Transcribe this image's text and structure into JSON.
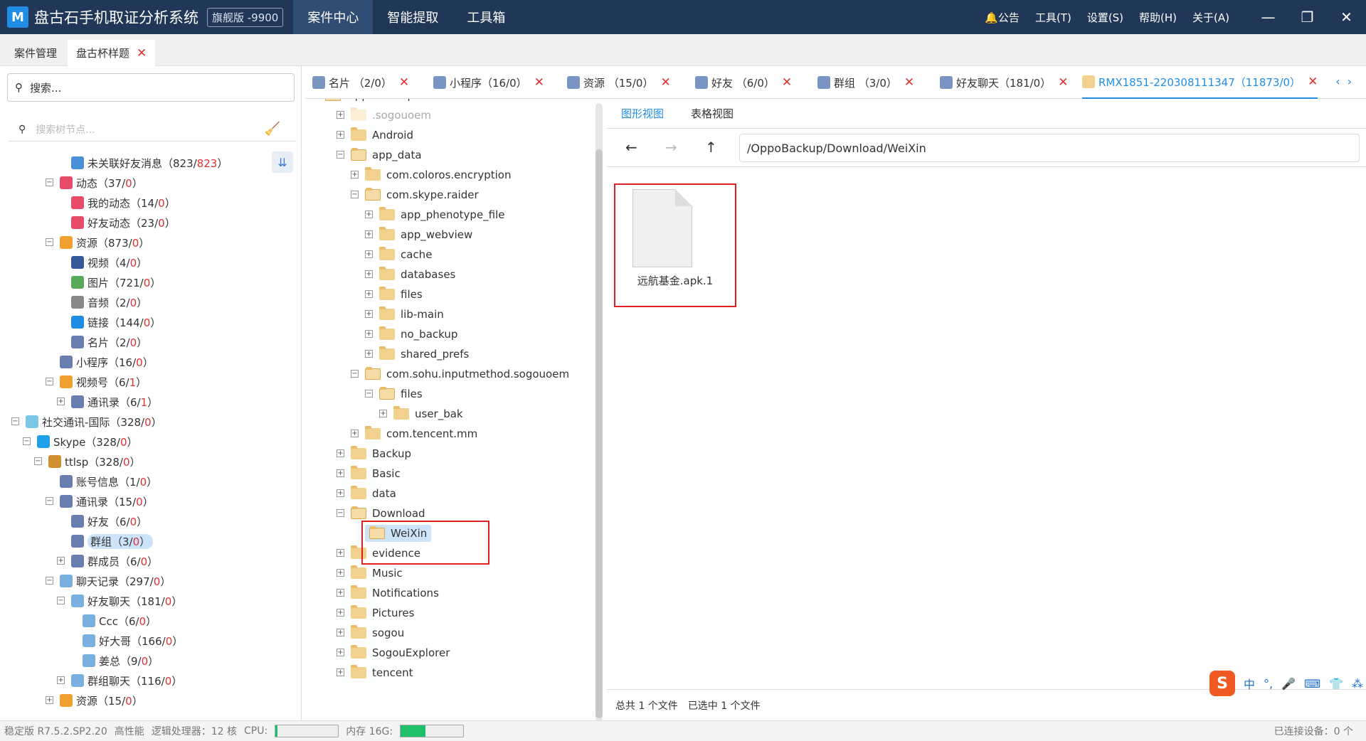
{
  "titlebar": {
    "logo": "M",
    "title": "盘古石手机取证分析系统",
    "edition": "旗舰版 -9900",
    "nav": [
      "案件中心",
      "智能提取",
      "工具箱"
    ],
    "right": [
      "公告",
      "工具(T)",
      "设置(S)",
      "帮助(H)",
      "关于(A)"
    ],
    "win": [
      "—",
      "❐",
      "✕"
    ]
  },
  "maintabs": [
    "案件管理",
    "盘古杯样题"
  ],
  "left": {
    "search": "搜索...",
    "filter": "搜索树节点...",
    "nodes": [
      {
        "label": "未关联好友消息（823/",
        "count": "823",
        "tail": "）"
      },
      {
        "label": "动态（37/",
        "count": "0",
        "tail": "）"
      },
      {
        "label": "我的动态（14/",
        "count": "0",
        "tail": "）"
      },
      {
        "label": "好友动态（23/",
        "count": "0",
        "tail": "）"
      },
      {
        "label": "资源（873/",
        "count": "0",
        "tail": "）"
      },
      {
        "label": "视频（4/",
        "count": "0",
        "tail": "）"
      },
      {
        "label": "图片（721/",
        "count": "0",
        "tail": "）"
      },
      {
        "label": "音频（2/",
        "count": "0",
        "tail": "）"
      },
      {
        "label": "链接（144/",
        "count": "0",
        "tail": "）"
      },
      {
        "label": "名片（2/",
        "count": "0",
        "tail": "）"
      },
      {
        "label": "小程序（16/",
        "count": "0",
        "tail": "）"
      },
      {
        "label": "视频号（6/",
        "count": "1",
        "tail": "）"
      },
      {
        "label": "通讯录（6/",
        "count": "1",
        "tail": "）"
      },
      {
        "label": "社交通讯-国际（328/",
        "count": "0",
        "tail": "）"
      },
      {
        "label": "Skype（328/",
        "count": "0",
        "tail": "）"
      },
      {
        "label": "ttlsp（328/",
        "count": "0",
        "tail": "）"
      },
      {
        "label": "账号信息（1/",
        "count": "0",
        "tail": "）"
      },
      {
        "label": "通讯录（15/",
        "count": "0",
        "tail": "）"
      },
      {
        "label": "好友（6/",
        "count": "0",
        "tail": "）"
      },
      {
        "label": "群组（3/",
        "count": "0",
        "tail": "）"
      },
      {
        "label": "群成员（6/",
        "count": "0",
        "tail": "）"
      },
      {
        "label": "聊天记录（297/",
        "count": "0",
        "tail": "）"
      },
      {
        "label": "好友聊天（181/",
        "count": "0",
        "tail": "）"
      },
      {
        "label": "Ccc（6/",
        "count": "0",
        "tail": "）"
      },
      {
        "label": "好大哥（166/",
        "count": "0",
        "tail": "）"
      },
      {
        "label": "姜总（9/",
        "count": "0",
        "tail": "）"
      },
      {
        "label": "群组聊天（116/",
        "count": "0",
        "tail": "）"
      },
      {
        "label": "资源（15/",
        "count": "0",
        "tail": "）"
      }
    ]
  },
  "ftabs": [
    {
      "label": "名片 （2/0）"
    },
    {
      "label": "小程序（16/0）"
    },
    {
      "label": "资源 （15/0）"
    },
    {
      "label": "好友 （6/0）"
    },
    {
      "label": "群组 （3/0）"
    },
    {
      "label": "好友聊天（181/0）"
    },
    {
      "label": "RMX1851-220308111347（11873/0）"
    }
  ],
  "folders": [
    "OppoBackup",
    ".sogouoem",
    "Android",
    "app_data",
    "com.coloros.encryption",
    "com.skype.raider",
    "app_phenotype_file",
    "app_webview",
    "cache",
    "databases",
    "files",
    "lib-main",
    "no_backup",
    "shared_prefs",
    "com.sohu.inputmethod.sogouoem",
    "files",
    "user_bak",
    "com.tencent.mm",
    "Backup",
    "Basic",
    "data",
    "Download",
    "WeiXin",
    "evidence",
    "Music",
    "Notifications",
    "Pictures",
    "sogou",
    "SogouExplorer",
    "tencent"
  ],
  "right": {
    "tabs": [
      "图形视图",
      "表格视图"
    ],
    "nav": [
      "←",
      "→",
      "↑"
    ],
    "path": "/OppoBackup/Download/WeiXin",
    "file": "远航基金.apk.1",
    "status": [
      "总共 1 个文件",
      "已选中 1 个文件"
    ]
  },
  "bottom": {
    "version": "稳定版 R7.5.2.SP2.20",
    "perf": "高性能",
    "cores": "逻辑处理器：12 核",
    "cpu": "CPU:",
    "mem": "内存 16G:",
    "mem_level": 0.4,
    "devices": "已连接设备：0 个"
  },
  "ime": [
    "S",
    "中",
    "°,",
    "🎤",
    "⌨",
    "👕",
    "⁂"
  ]
}
